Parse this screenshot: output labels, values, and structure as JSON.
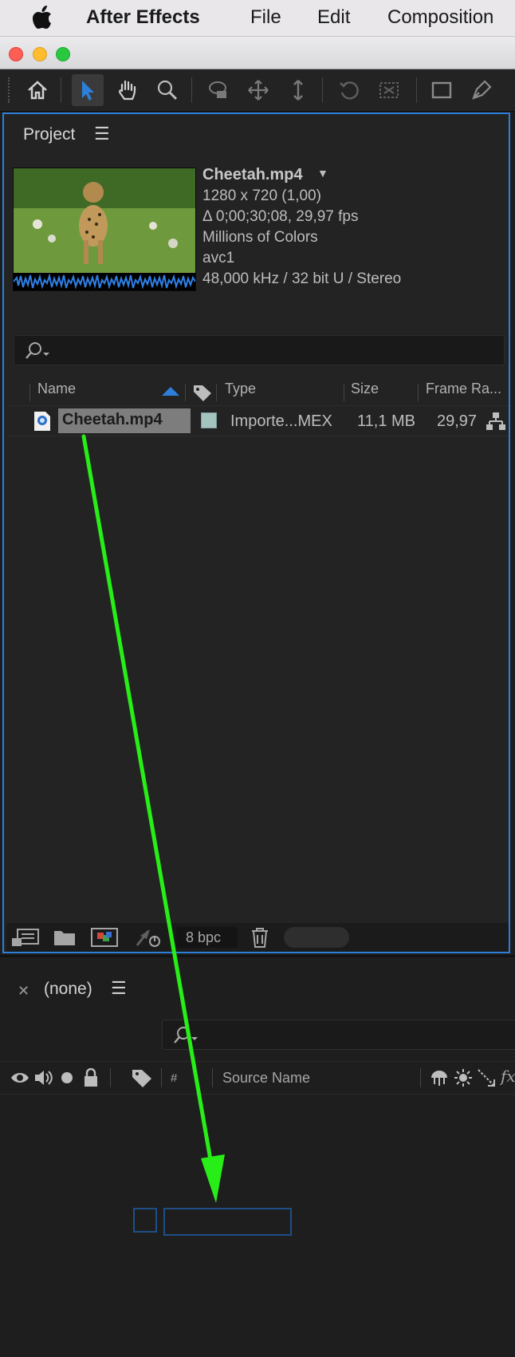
{
  "menubar": {
    "apple_icon": "apple-logo",
    "app_name": "After Effects",
    "items": [
      "File",
      "Edit",
      "Composition"
    ]
  },
  "toolbar": {
    "tools": [
      "home-icon",
      "selection-arrow-icon",
      "hand-icon",
      "zoom-icon",
      "rotation-icon",
      "camera-orbit-icon",
      "move-icon",
      "dolly-icon",
      "pan-behind-icon",
      "rectangle-icon",
      "pen-icon"
    ],
    "active_tool": "selection-arrow-icon"
  },
  "project": {
    "title": "Project",
    "footage": {
      "name": "Cheetah.mp4",
      "dimensions": "1280 x 720 (1,00)",
      "duration": "Δ 0;00;30;08, 29,97 fps",
      "colors": "Millions of Colors",
      "codec": "avc1",
      "audio": "48,000 kHz / 32 bit U / Stereo"
    },
    "columns": {
      "name": "Name",
      "type": "Type",
      "size": "Size",
      "frame_rate": "Frame Ra..."
    },
    "row": {
      "name": "Cheetah.mp4",
      "type": "Importe...MEX",
      "size": "11,1 MB",
      "frame_rate": "29,97",
      "label_color": "#a3c4bf"
    },
    "bottom": {
      "bpc": "8 bpc"
    }
  },
  "timeline": {
    "title": "(none)",
    "columns": {
      "hash": "#",
      "source_name": "Source Name",
      "fx": "fx"
    }
  },
  "colors": {
    "accent_blue": "#2d7fd9",
    "arrow_green": "#28ee18"
  }
}
